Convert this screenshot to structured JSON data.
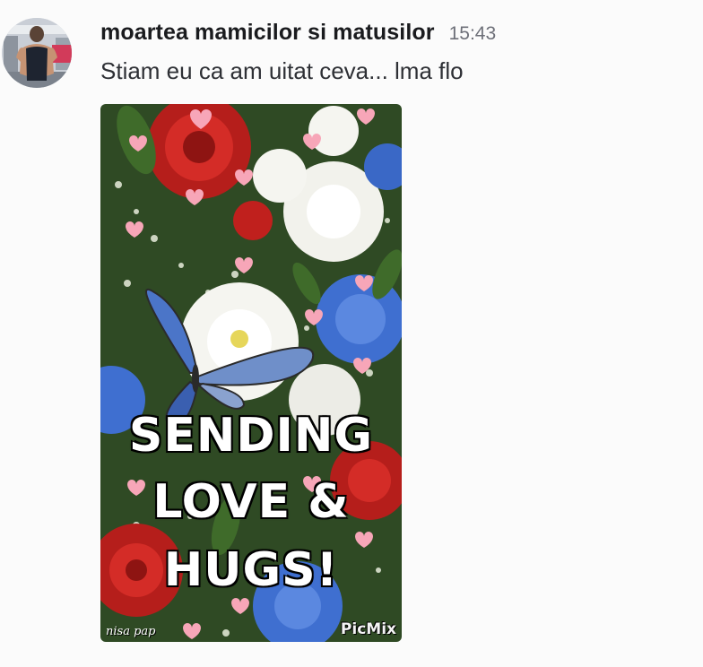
{
  "message": {
    "author": {
      "name": "moartea mamicilor si matusilor",
      "avatar_icon": "user-avatar"
    },
    "timestamp": "15:43",
    "text": "Stiam eu ca am uitat ceva... lma flo",
    "attachment": {
      "type": "gif",
      "caption_lines": [
        "SENDING",
        "LOVE &",
        "HUGS!"
      ],
      "watermark": "PicMix",
      "signature": "nisa pap",
      "colors": {
        "red_rose": "#c0201d",
        "blue_flower": "#3f6fd0",
        "white_flower": "#f5f5f0",
        "foliage": "#2f4a24",
        "heart": "#f7a6b8"
      }
    }
  }
}
